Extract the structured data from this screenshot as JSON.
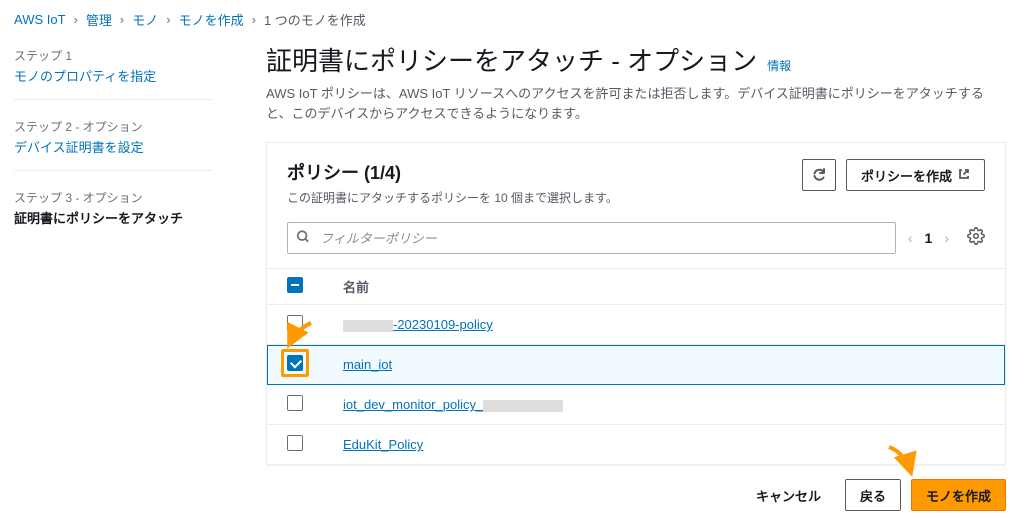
{
  "breadcrumb": {
    "items": [
      "AWS IoT",
      "管理",
      "モノ",
      "モノを作成"
    ],
    "current": "1 つのモノを作成"
  },
  "steps": [
    {
      "label": "ステップ 1",
      "title": "モノのプロパティを指定",
      "link": true
    },
    {
      "label": "ステップ 2 - オプション",
      "title": "デバイス証明書を設定",
      "link": true
    },
    {
      "label": "ステップ 3 - オプション",
      "title": "証明書にポリシーをアタッチ",
      "active": true
    }
  ],
  "page": {
    "title": "証明書にポリシーをアタッチ - オプション",
    "info": "情報",
    "desc": "AWS IoT ポリシーは、AWS IoT リソースへのアクセスを許可または拒否します。デバイス証明書にポリシーをアタッチすると、このデバイスからアクセスできるようになります。"
  },
  "panel": {
    "title": "ポリシー (1/4)",
    "sub": "この証明書にアタッチするポリシーを 10 個まで選択します。",
    "refresh_aria": "更新",
    "create_label": "ポリシーを作成"
  },
  "filter": {
    "placeholder": "フィルターポリシー"
  },
  "pager": {
    "page": "1"
  },
  "table": {
    "header_name": "名前",
    "rows": [
      {
        "name_suffix": "-20230109-policy",
        "checked": false,
        "redact_before": true
      },
      {
        "name": "main_iot",
        "checked": true
      },
      {
        "name_prefix": "iot_dev_monitor_policy_",
        "checked": false,
        "redact_after": true
      },
      {
        "name": "EduKit_Policy",
        "checked": false
      }
    ]
  },
  "footer": {
    "cancel": "キャンセル",
    "back": "戻る",
    "create": "モノを作成"
  }
}
